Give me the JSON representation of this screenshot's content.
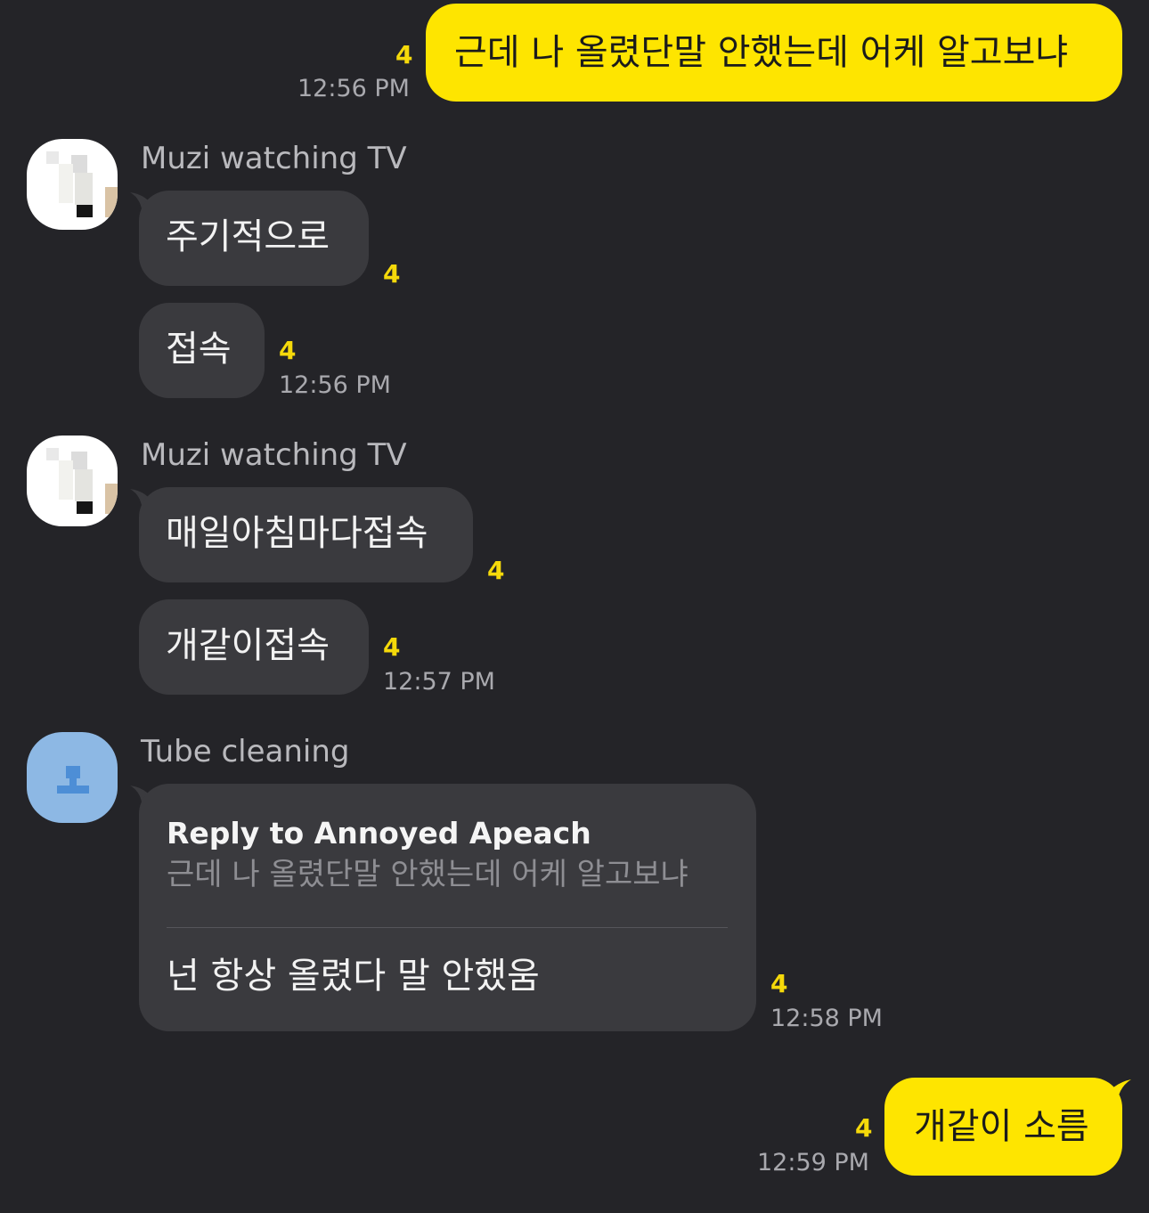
{
  "messages": [
    {
      "text": "근데 나 올렸단말 안했는데 어케 알고보냐",
      "unread": "4",
      "time": "12:56 PM"
    },
    {
      "sender": "Muzi watching TV",
      "bubbles": [
        {
          "text": "주기적으로",
          "unread": "4"
        },
        {
          "text": "접속",
          "unread": "4",
          "time": "12:56 PM"
        }
      ]
    },
    {
      "sender": "Muzi watching TV",
      "bubbles": [
        {
          "text": "매일아침마다접속",
          "unread": "4"
        },
        {
          "text": "개같이접속",
          "unread": "4",
          "time": "12:57 PM"
        }
      ]
    },
    {
      "sender": "Tube cleaning",
      "reply_to": "Reply to Annoyed Apeach",
      "quoted": "근데 나 올렸단말 안했는데 어케 알고보냐",
      "text": "넌 항상 올렸다 말 안했움",
      "unread": "4",
      "time": "12:58 PM"
    },
    {
      "text": "개같이 소름",
      "unread": "4",
      "time": "12:59 PM"
    }
  ],
  "colors": {
    "background": "#242428",
    "outgoing_bubble": "#fee500",
    "incoming_bubble": "#3a3a3e",
    "unread_count": "#f5d90a"
  }
}
